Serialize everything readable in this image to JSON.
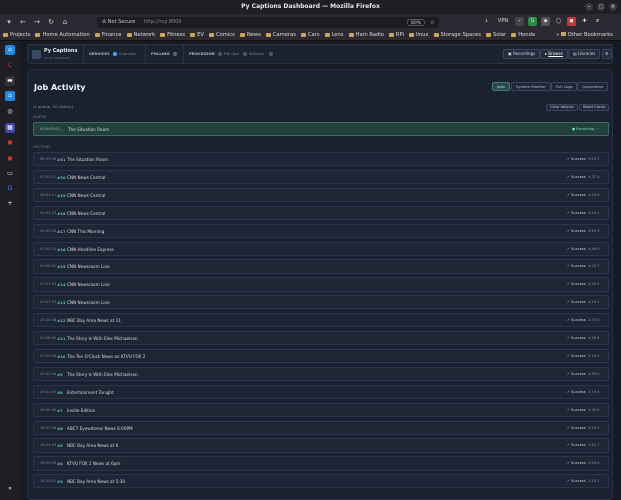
{
  "window": {
    "title": "Py Captions Dashboard — Mozilla Firefox"
  },
  "browser": {
    "not_secure": "Not Secure",
    "url": "http://ruy:8000",
    "zoom": "80%",
    "vpn": "VPN"
  },
  "bookmarks": [
    "Projects",
    "Home Automation",
    "Finance",
    "Network",
    "Fitness",
    "EV",
    "Comics",
    "News",
    "Cameras",
    "Cars",
    "Lens",
    "Ham Radio",
    "RPi",
    "linux",
    "Storage Spaces",
    "Solar",
    "Honda"
  ],
  "other_bookmarks": "Other Bookmarks",
  "app": {
    "brand": "Py Captions",
    "sub": "v1.0.0 dashboard",
    "services_label": "SERVICES",
    "services_value": "Channels DVR",
    "polling_label": "POLLING",
    "processor_label": "PROCESSOR",
    "file_ops": "File Ops",
    "Whisper": "Whisper",
    "privacy": "Privacy",
    "btn_recordings": "Recordings",
    "btn_browse": "Browse",
    "btn_libraries": "Libraries"
  },
  "page": {
    "title": "Job Activity",
    "tabs": [
      "Jobs",
      "System Monitor",
      "Full Logs",
      "Quarantine"
    ],
    "summary": "(1 queue, 30 history)",
    "clear_failures": "Clear failures",
    "reset_cache": "Reset Cache",
    "queue_label": "QUEUE",
    "history_label": "HISTORY"
  },
  "queue": {
    "time": "0:00:00:00",
    "show": "The Situation Room",
    "status": "● Recording ···"
  },
  "history": [
    {
      "time": "08:01:30",
      "channel": "#31",
      "show": "The Situation Room",
      "status": "✓ Success",
      "duration": "5:03.7"
    },
    {
      "time": "07:01:21",
      "channel": "#20",
      "show": "CNN News Central",
      "status": "✓ Success",
      "duration": "4:37.4"
    },
    {
      "time": "06:01:11",
      "channel": "#19",
      "show": "CNN News Central",
      "status": "✓ Success",
      "duration": "4:34.6"
    },
    {
      "time": "05:01:33",
      "channel": "#18",
      "show": "CNN News Central",
      "status": "✓ Success",
      "duration": "4:24.1"
    },
    {
      "time": "04:02:18",
      "channel": "#17",
      "show": "CNN This Morning",
      "status": "✓ Success",
      "duration": "4:40.3"
    },
    {
      "time": "03:02:15",
      "channel": "#16",
      "show": "CNN Headline Express",
      "status": "✓ Success",
      "duration": "4:46.9"
    },
    {
      "time": "03:00:01",
      "channel": "#15",
      "show": "CNN Newsroom Live",
      "status": "✓ Success",
      "duration": "4:05.7"
    },
    {
      "time": "01:01:53",
      "channel": "#14",
      "show": "CNN Newsroom Live",
      "status": "✓ Success",
      "duration": "4:35.2"
    },
    {
      "time": "00:01:33",
      "channel": "#13",
      "show": "CNN Newsroom Live",
      "status": "✓ Success",
      "duration": "4:19.1"
    },
    {
      "time": "23:30:38",
      "channel": "#12",
      "show": "NBC Bay Area News at 11",
      "status": "✓ Success",
      "duration": "2:47.5"
    },
    {
      "time": "23:06:30",
      "channel": "#11",
      "show": "The Story Is With Elex Michaelson",
      "status": "✓ Success",
      "duration": "4:28.4"
    },
    {
      "time": "23:05:43",
      "channel": "#10",
      "show": "The Ten O'Clock News on KTVU FOX 2",
      "status": "✓ Success",
      "duration": "5:14.4"
    },
    {
      "time": "22:02:58",
      "channel": "#9",
      "show": "The Story Is With Elex Michaelson",
      "status": "✓ Success",
      "duration": "3:59.0"
    },
    {
      "time": "20:01:55",
      "channel": "#8",
      "show": "Entertainment Tonight",
      "status": "✓ Success",
      "duration": "3:19.5"
    },
    {
      "time": "19:30:30",
      "channel": "#7",
      "show": "Inside Edition",
      "status": "✓ Success",
      "duration": "2:30.9"
    },
    {
      "time": "18:01:58",
      "channel": "#6",
      "show": "ABC7 Eyewitness News 6:00PM",
      "status": "✓ Success",
      "duration": "5:24.1"
    },
    {
      "time": "18:03:53",
      "channel": "#5",
      "show": "NBC Bay Area News at 6",
      "status": "✓ Success",
      "duration": "2:42.7"
    },
    {
      "time": "18:00:43",
      "channel": "#4",
      "show": "KTVU FOX 2 News at 6pm",
      "status": "✓ Success",
      "duration": "2:54.0"
    },
    {
      "time": "18:00:01",
      "channel": "#3",
      "show": "NBC Bay Area News at 5:30",
      "status": "✓ Success",
      "duration": "2:53.1"
    }
  ]
}
